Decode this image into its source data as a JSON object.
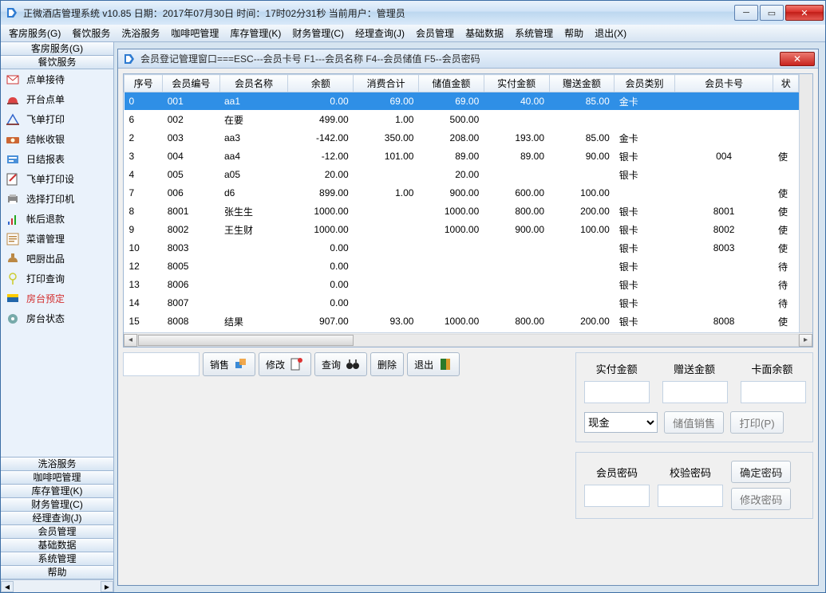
{
  "window": {
    "title": "正微酒店管理系统 v10.85    日期：2017年07月30日    时间：17时02分31秒    当前用户：管理员"
  },
  "menus": [
    "客房服务(G)",
    "餐饮服务",
    "洗浴服务",
    "咖啡吧管理",
    "库存管理(K)",
    "财务管理(C)",
    "经理查询(J)",
    "会员管理",
    "基础数据",
    "系统管理",
    "帮助",
    "退出(X)"
  ],
  "sidebar": {
    "header1": "客房服务(G)",
    "header2": "餐饮服务",
    "items": [
      {
        "label": "点单接待"
      },
      {
        "label": "开台点单"
      },
      {
        "label": "飞单打印"
      },
      {
        "label": "结帐收银"
      },
      {
        "label": "日结报表"
      },
      {
        "label": "飞单打印设"
      },
      {
        "label": "选择打印机"
      },
      {
        "label": "帐后退款"
      },
      {
        "label": "菜谱管理"
      },
      {
        "label": "吧厨出品"
      },
      {
        "label": "打印查询"
      },
      {
        "label": "房台预定",
        "highlight": true
      },
      {
        "label": "房台状态"
      }
    ],
    "cats": [
      "洗浴服务",
      "咖啡吧管理",
      "库存管理(K)",
      "财务管理(C)",
      "经理查询(J)",
      "会员管理",
      "基础数据",
      "系统管理",
      "帮助"
    ]
  },
  "inner": {
    "title": "会员登记管理窗口===ESC---会员卡号   F1---会员名称   F4--会员储值   F5--会员密码"
  },
  "grid": {
    "columns": [
      "序号",
      "会员编号",
      "会员名称",
      "余额",
      "消费合计",
      "储值金额",
      "实付金额",
      "赠送金额",
      "会员类别",
      "会员卡号",
      "状"
    ],
    "rows": [
      {
        "seq": "0",
        "no": "001",
        "name": "aa1",
        "bal": "0.00",
        "consume": "69.00",
        "stored": "69.00",
        "paid": "40.00",
        "bonus": "85.00",
        "type": "金卡",
        "card": "",
        "status": ""
      },
      {
        "seq": "6",
        "no": "002",
        "name": "在要",
        "bal": "499.00",
        "consume": "1.00",
        "stored": "500.00",
        "paid": "",
        "bonus": "",
        "type": "",
        "card": "",
        "status": ""
      },
      {
        "seq": "2",
        "no": "003",
        "name": "aa3",
        "bal": "-142.00",
        "consume": "350.00",
        "stored": "208.00",
        "paid": "193.00",
        "bonus": "85.00",
        "type": "金卡",
        "card": "",
        "status": ""
      },
      {
        "seq": "3",
        "no": "004",
        "name": "aa4",
        "bal": "-12.00",
        "consume": "101.00",
        "stored": "89.00",
        "paid": "89.00",
        "bonus": "90.00",
        "type": "银卡",
        "card": "004",
        "status": "使"
      },
      {
        "seq": "4",
        "no": "005",
        "name": "a05",
        "bal": "20.00",
        "consume": "",
        "stored": "20.00",
        "paid": "",
        "bonus": "",
        "type": "银卡",
        "card": "",
        "status": ""
      },
      {
        "seq": "7",
        "no": "006",
        "name": "d6",
        "bal": "899.00",
        "consume": "1.00",
        "stored": "900.00",
        "paid": "600.00",
        "bonus": "100.00",
        "type": "",
        "card": "",
        "status": "使"
      },
      {
        "seq": "8",
        "no": "8001",
        "name": "张生生",
        "bal": "1000.00",
        "consume": "",
        "stored": "1000.00",
        "paid": "800.00",
        "bonus": "200.00",
        "type": "银卡",
        "card": "8001",
        "status": "使"
      },
      {
        "seq": "9",
        "no": "8002",
        "name": "王生财",
        "bal": "1000.00",
        "consume": "",
        "stored": "1000.00",
        "paid": "900.00",
        "bonus": "100.00",
        "type": "银卡",
        "card": "8002",
        "status": "使"
      },
      {
        "seq": "10",
        "no": "8003",
        "name": "",
        "bal": "0.00",
        "consume": "",
        "stored": "",
        "paid": "",
        "bonus": "",
        "type": "银卡",
        "card": "8003",
        "status": "使"
      },
      {
        "seq": "12",
        "no": "8005",
        "name": "",
        "bal": "0.00",
        "consume": "",
        "stored": "",
        "paid": "",
        "bonus": "",
        "type": "银卡",
        "card": "",
        "status": "待"
      },
      {
        "seq": "13",
        "no": "8006",
        "name": "",
        "bal": "0.00",
        "consume": "",
        "stored": "",
        "paid": "",
        "bonus": "",
        "type": "银卡",
        "card": "",
        "status": "待"
      },
      {
        "seq": "14",
        "no": "8007",
        "name": "",
        "bal": "0.00",
        "consume": "",
        "stored": "",
        "paid": "",
        "bonus": "",
        "type": "银卡",
        "card": "",
        "status": "待"
      },
      {
        "seq": "15",
        "no": "8008",
        "name": "结果",
        "bal": "907.00",
        "consume": "93.00",
        "stored": "1000.00",
        "paid": "800.00",
        "bonus": "200.00",
        "type": "银卡",
        "card": "8008",
        "status": "使"
      }
    ]
  },
  "toolbar": {
    "sell": "销售",
    "modify": "修改",
    "query": "查询",
    "delete": "删除",
    "exit": "退出"
  },
  "panel1": {
    "labels": [
      "实付金额",
      "赠送金额",
      "卡面余额"
    ],
    "combo": "现金",
    "store_sell": "储值销售",
    "print": "打印(P)"
  },
  "panel2": {
    "pw_label": "会员密码",
    "check_label": "校验密码",
    "ok": "确定密码",
    "change": "修改密码"
  }
}
